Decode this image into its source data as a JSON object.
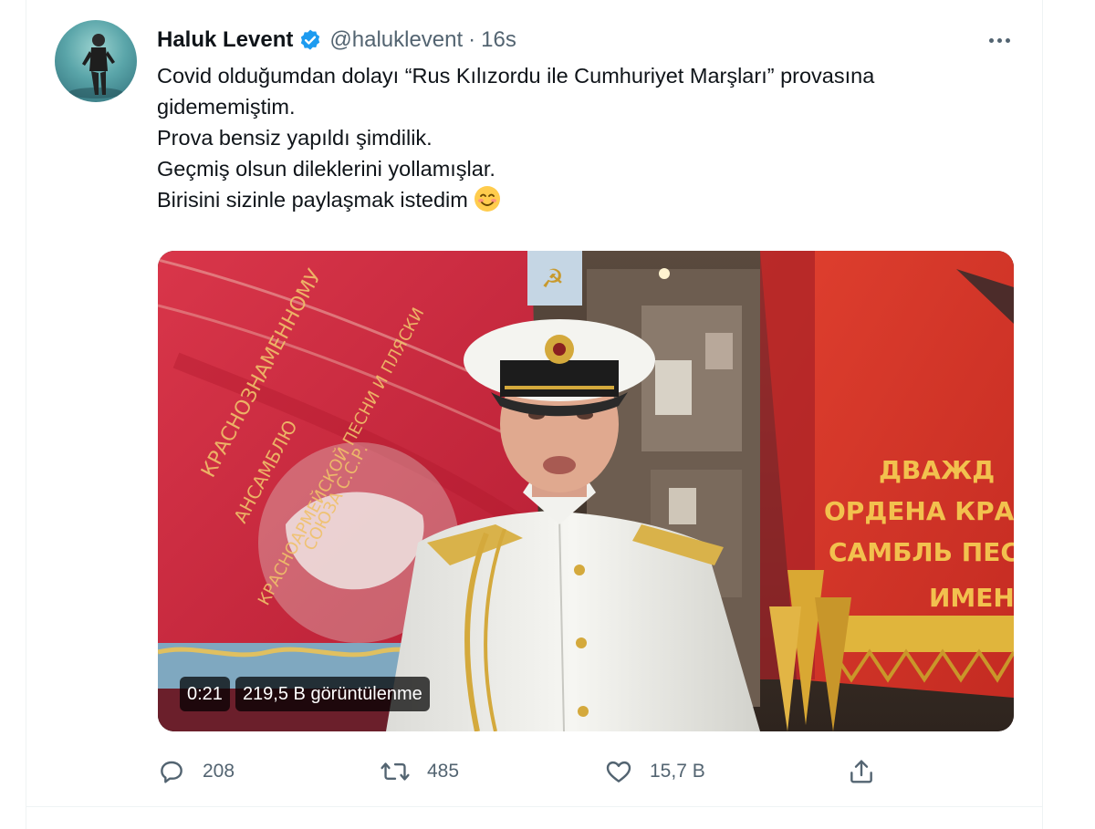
{
  "tweet": {
    "author_name": "Haluk Levent",
    "handle": "@haluklevent",
    "separator": "·",
    "time": "16s",
    "text_lines": [
      "Covid olduğumdan dolayı “Rus Kılızordu ile Cumhuriyet Marşları” provasına",
      "gidememiştim.",
      "Prova bensiz yapıldı şimdilik.",
      "Geçmiş olsun dileklerini yollamışlar.",
      "Birisini sizinle paylaşmak istedim"
    ],
    "emoji": "smiling-face-with-smiling-eyes"
  },
  "video": {
    "duration": "0:21",
    "views": "219,5 B görüntülenme"
  },
  "actions": {
    "reply_count": "208",
    "retweet_count": "485",
    "like_count": "15,7 B"
  },
  "colors": {
    "verified_badge": "#1d9bf0",
    "secondary_text": "#536471",
    "primary_text": "#0f1419",
    "banner_red": "#c8283a"
  }
}
